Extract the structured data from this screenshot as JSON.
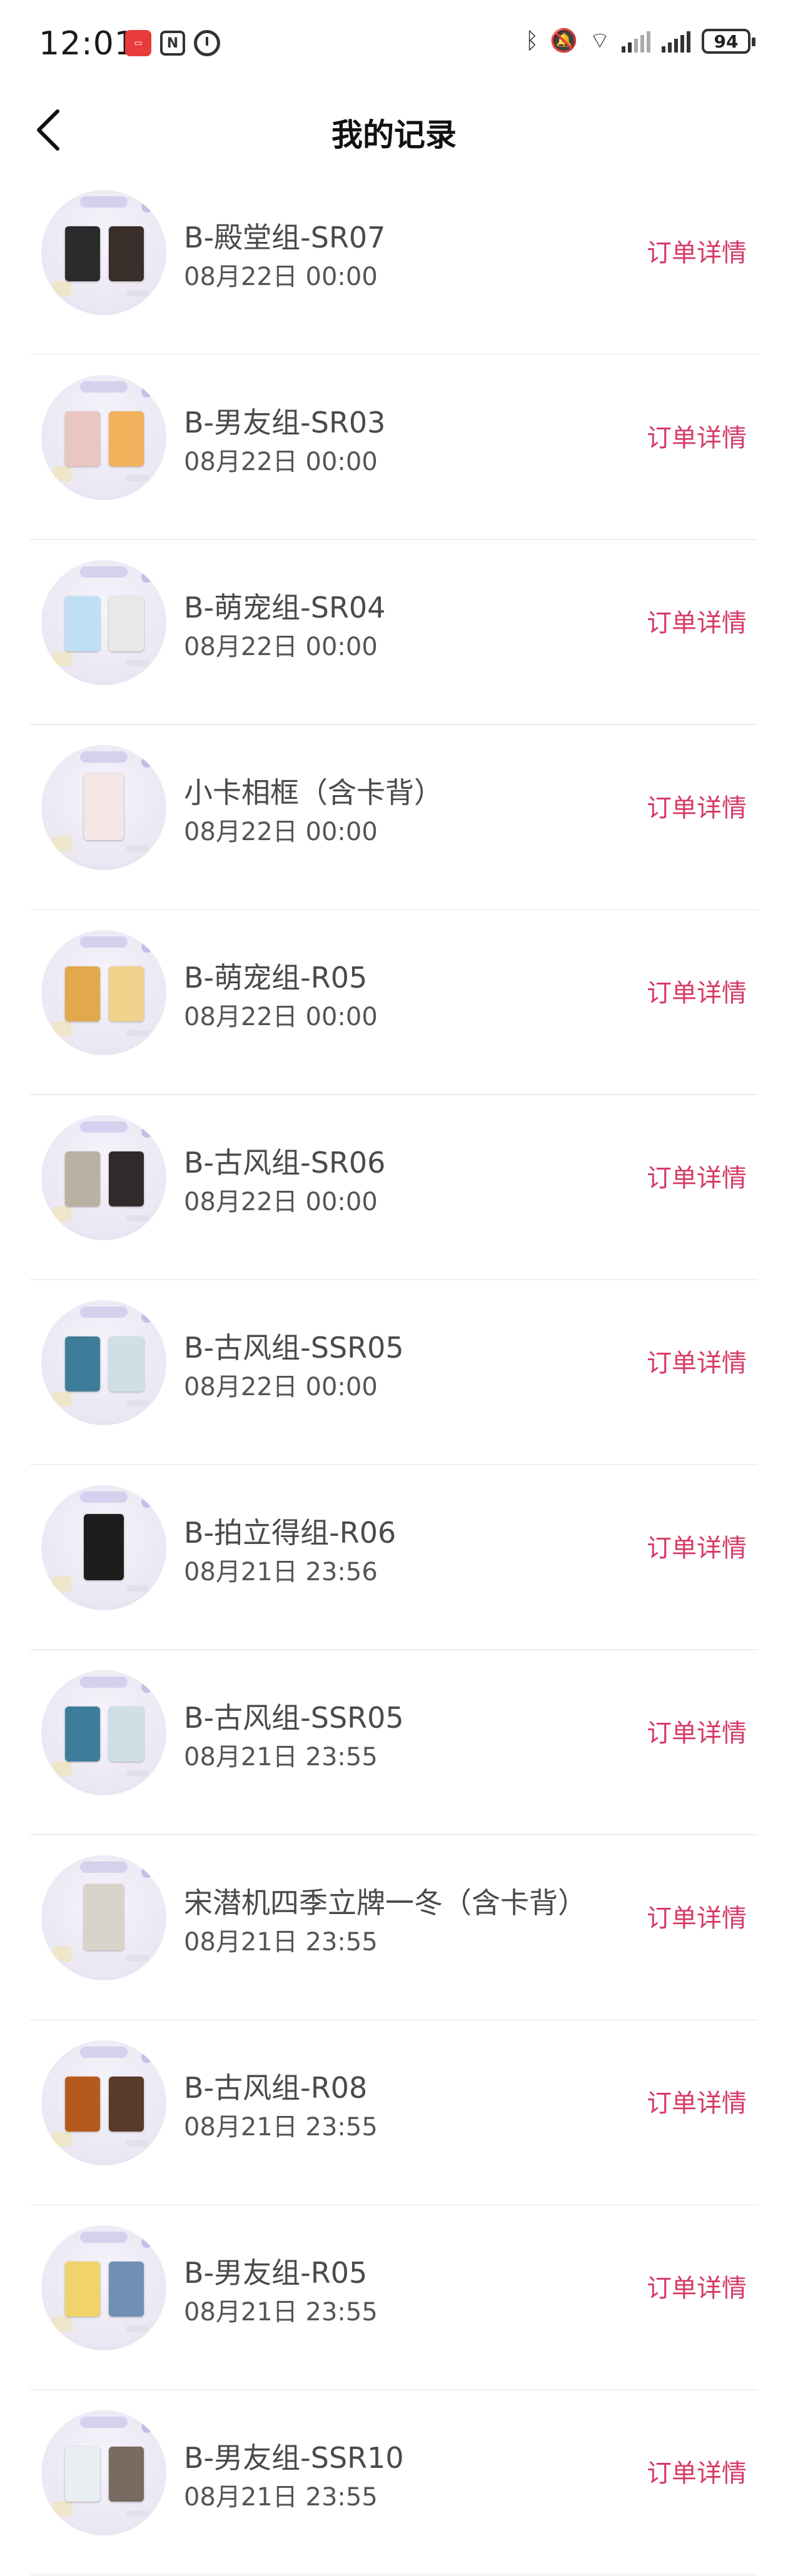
{
  "status_bar": {
    "time": "12:01",
    "battery": "94",
    "icons": [
      "red-app-badge-icon",
      "nfc-icon",
      "alarm-icon",
      "bluetooth-icon",
      "mute-icon",
      "wifi-icon",
      "signal-icon",
      "signal-icon-2"
    ]
  },
  "header": {
    "title": "我的记录",
    "back_icon": "chevron-left-icon"
  },
  "detail_label": "订单详情",
  "records": [
    {
      "title": "B-殿堂组-SR07",
      "date": "08月22日 00:00",
      "colors": [
        "#2b2b2e",
        "#3a2e2a"
      ]
    },
    {
      "title": "B-男友组-SR03",
      "date": "08月22日 00:00",
      "colors": [
        "#e9c6c0",
        "#f2b25c"
      ]
    },
    {
      "title": "B-萌宠组-SR04",
      "date": "08月22日 00:00",
      "colors": [
        "#bfe0f4",
        "#e8e8e8"
      ]
    },
    {
      "title": "小卡相框（含卡背）",
      "date": "08月22日 00:00",
      "colors": [
        "#f3e6e4",
        "#f3e6e4"
      ],
      "single": true
    },
    {
      "title": "B-萌宠组-R05",
      "date": "08月22日 00:00",
      "colors": [
        "#e2a84c",
        "#f0d28a"
      ]
    },
    {
      "title": "B-古风组-SR06",
      "date": "08月22日 00:00",
      "colors": [
        "#b9b1a2",
        "#2f2b2b"
      ]
    },
    {
      "title": "B-古风组-SSR05",
      "date": "08月22日 00:00",
      "colors": [
        "#3e7d9a",
        "#cfdfe6"
      ]
    },
    {
      "title": "B-拍立得组-R06",
      "date": "08月21日 23:56",
      "colors": [
        "#1d1d1d",
        "#1d1d1d"
      ],
      "single": true
    },
    {
      "title": "B-古风组-SSR05",
      "date": "08月21日 23:55",
      "colors": [
        "#3e7d9a",
        "#cfdfe6"
      ]
    },
    {
      "title": "宋潜机四季立牌一冬（含卡背）",
      "date": "08月21日 23:55",
      "colors": [
        "#d9d4c9",
        "#d9d4c9"
      ],
      "single": true
    },
    {
      "title": "B-古风组-R08",
      "date": "08月21日 23:55",
      "colors": [
        "#b6591e",
        "#5a3a2a"
      ]
    },
    {
      "title": "B-男友组-R05",
      "date": "08月21日 23:55",
      "colors": [
        "#f0d36a",
        "#6f8fb3"
      ]
    },
    {
      "title": "B-男友组-SSR10",
      "date": "08月21日 23:55",
      "colors": [
        "#e9eef3",
        "#7a6a62"
      ]
    }
  ]
}
